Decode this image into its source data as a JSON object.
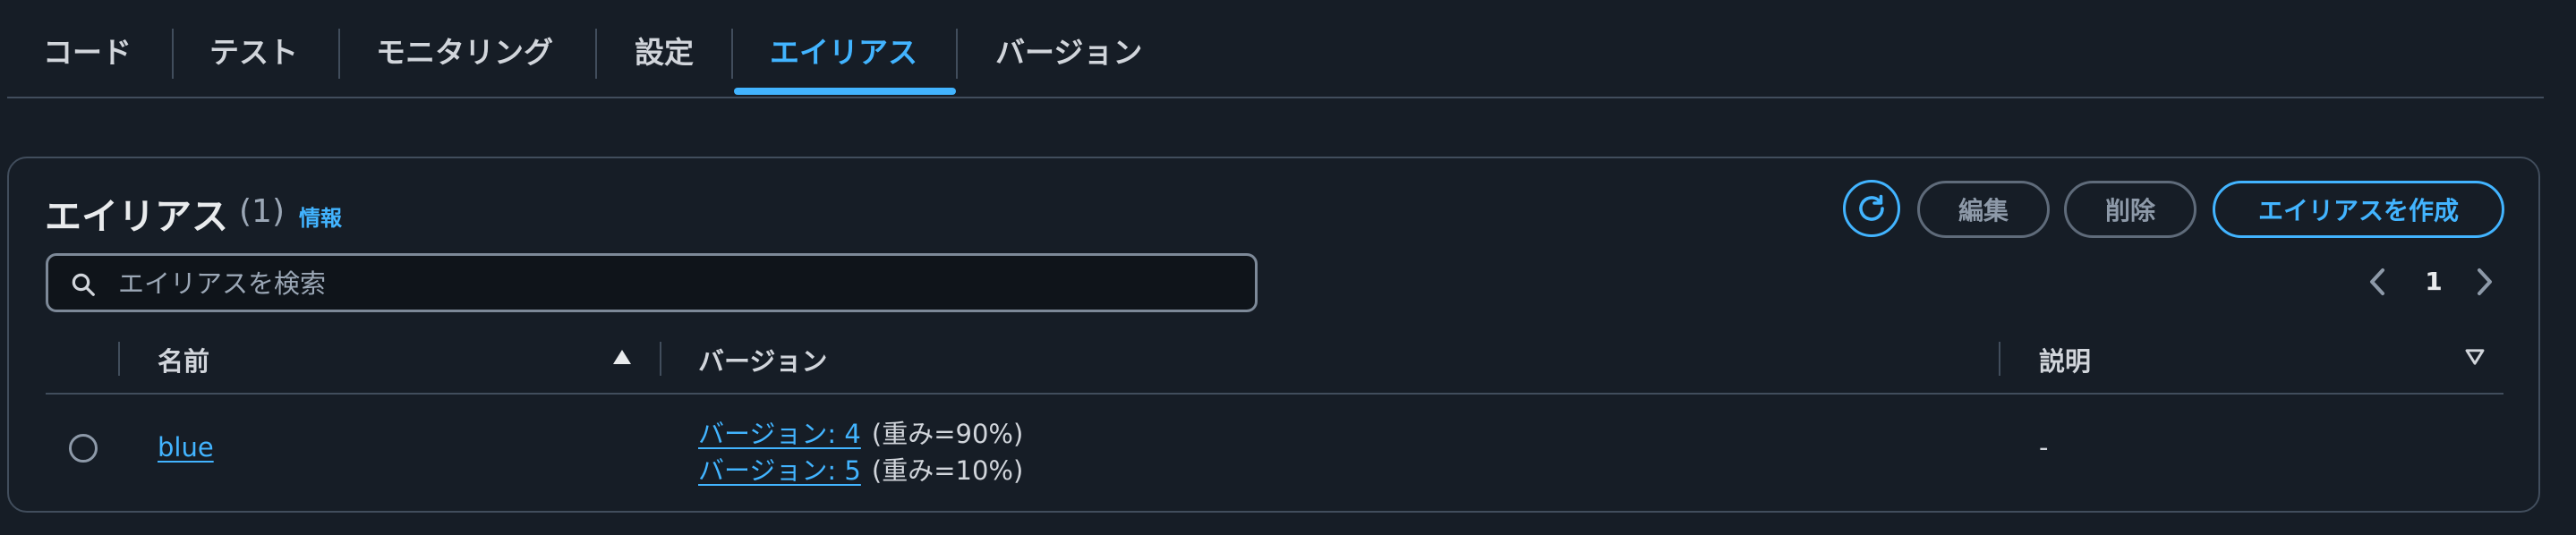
{
  "tabs": [
    {
      "label": "コード",
      "active": false
    },
    {
      "label": "テスト",
      "active": false
    },
    {
      "label": "モニタリング",
      "active": false
    },
    {
      "label": "設定",
      "active": false
    },
    {
      "label": "エイリアス",
      "active": true
    },
    {
      "label": "バージョン",
      "active": false
    }
  ],
  "panel": {
    "title": "エイリアス",
    "count": "(1)",
    "info_link": "情報"
  },
  "actions": {
    "refresh_icon": "refresh-icon",
    "edit_label": "編集",
    "edit_disabled": true,
    "delete_label": "削除",
    "delete_disabled": true,
    "create_label": "エイリアスを作成"
  },
  "search": {
    "placeholder": "エイリアスを検索",
    "value": "",
    "icon": "search-icon"
  },
  "pagination": {
    "current_page": "1",
    "prev_icon": "chevron-left-icon",
    "next_icon": "chevron-right-icon"
  },
  "table": {
    "columns": [
      {
        "label": "名前",
        "sort": "ascending"
      },
      {
        "label": "バージョン"
      },
      {
        "label": "説明",
        "sort": "descending"
      }
    ],
    "rows": [
      {
        "name": "blue",
        "selected": false,
        "versions": [
          {
            "label": "バージョン: 4",
            "weight": "(重み=90%)"
          },
          {
            "label": "バージョン: 5",
            "weight": "(重み=10%)"
          }
        ],
        "description": "-"
      }
    ]
  },
  "colors": {
    "background": "#161d26",
    "accent": "#42b4ff",
    "border": "#414d5c",
    "text": "#d1d5db",
    "disabled": "#8d99a8"
  }
}
